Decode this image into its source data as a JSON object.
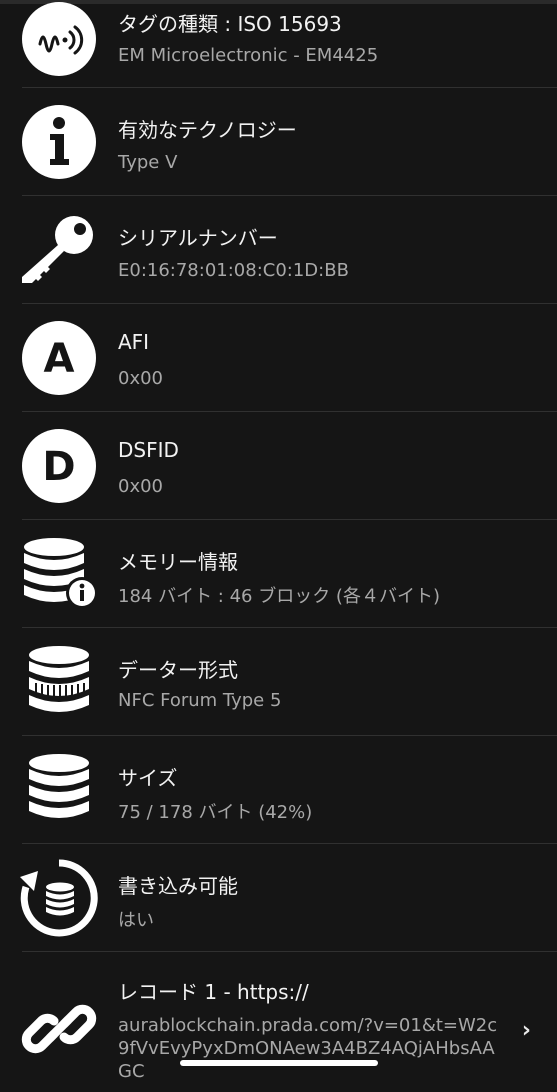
{
  "rows": [
    {
      "title": "タグの種類 : ISO 15693",
      "subtitle": "EM Microelectronic - EM4425",
      "icon": "nfc-tag-icon"
    },
    {
      "title": "有効なテクノロジー",
      "subtitle": "Type V",
      "icon": "info-icon"
    },
    {
      "title": "シリアルナンバー",
      "subtitle": "E0:16:78:01:08:C0:1D:BB",
      "icon": "key-icon"
    },
    {
      "title": "AFI",
      "subtitle": "0x00",
      "icon": "letter-a-icon"
    },
    {
      "title": "DSFID",
      "subtitle": "0x00",
      "icon": "letter-d-icon"
    },
    {
      "title": "メモリー情報",
      "subtitle": "184 バイト : 46 ブロック (各４バイト)",
      "icon": "database-info-icon"
    },
    {
      "title": "データー形式",
      "subtitle": "NFC Forum Type 5",
      "icon": "database-format-icon"
    },
    {
      "title": "サイズ",
      "subtitle": "75 / 178 バイト (42%)",
      "icon": "database-size-icon"
    },
    {
      "title": "書き込み可能",
      "subtitle": "はい",
      "icon": "database-rewrite-icon"
    },
    {
      "title": "レコード 1 - https://",
      "subtitle": "aurablockchain.prada.com/?v=01&t=W2c9fVvEvyPyxDmONAew3A4BZ4AQjAHbsAAGC",
      "icon": "link-icon",
      "chevron": "›"
    }
  ]
}
